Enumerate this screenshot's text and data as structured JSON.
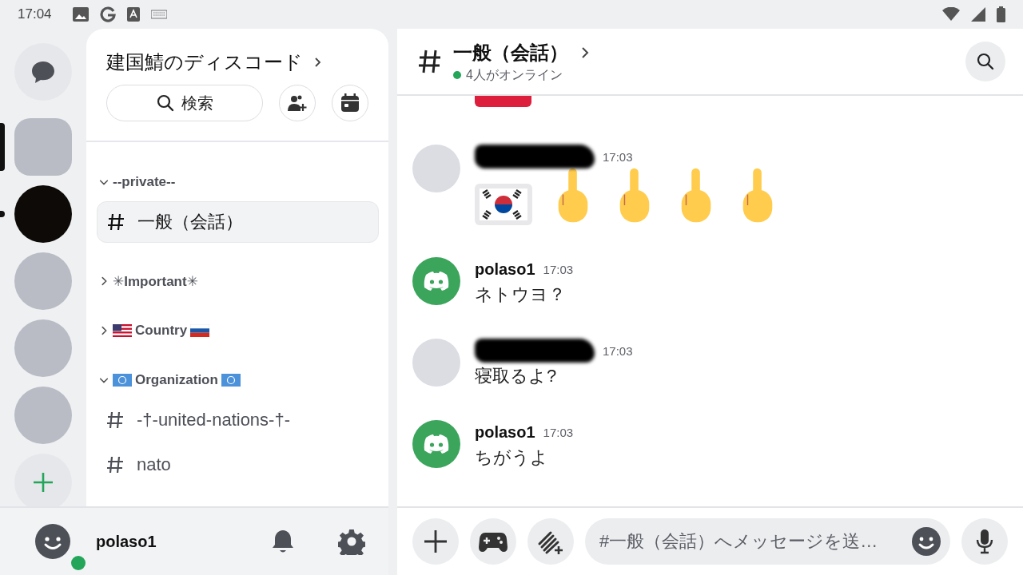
{
  "status_bar": {
    "time": "17:04"
  },
  "servers": [
    {
      "kind": "dm",
      "selected": false,
      "unread": false
    },
    {
      "kind": "photo",
      "selected": true,
      "unread": false
    },
    {
      "kind": "dark",
      "selected": false,
      "unread": true
    },
    {
      "kind": "photo",
      "selected": false,
      "unread": false
    },
    {
      "kind": "photo",
      "selected": false,
      "unread": false
    },
    {
      "kind": "photo",
      "selected": false,
      "unread": false
    },
    {
      "kind": "add",
      "selected": false,
      "unread": false
    }
  ],
  "server": {
    "name": "建国鯖のディスコード",
    "search": "検索"
  },
  "categories": [
    {
      "name": "--private--",
      "expanded": true,
      "channels": [
        {
          "name": "一般（会話）",
          "selected": true
        }
      ]
    },
    {
      "name": "✳Important✳",
      "expanded": false
    },
    {
      "name": "Country",
      "expanded": false,
      "flags": [
        {
          "kind": "us"
        },
        {
          "kind": "ru"
        }
      ]
    },
    {
      "name": "Organization",
      "expanded": true,
      "flags": [
        {
          "kind": "un"
        },
        {
          "kind": "un"
        }
      ],
      "channels": [
        {
          "name": "-†-united-nations-†-",
          "selected": false
        },
        {
          "name": "nato",
          "selected": false
        }
      ]
    }
  ],
  "user": {
    "name": "polaso1",
    "online": true
  },
  "chat": {
    "channel": "一般（会話）",
    "online": "4人がオンライン",
    "messages": [
      {
        "kind": "image"
      },
      {
        "kind": "message",
        "avatar": {
          "kind": "photo"
        },
        "author": {
          "redacted": true
        },
        "time": "17:03",
        "emoji": [
          {
            "kind": "flag"
          },
          {
            "kind": "hand"
          },
          {
            "kind": "hand"
          },
          {
            "kind": "hand"
          },
          {
            "kind": "hand"
          }
        ]
      },
      {
        "kind": "message",
        "avatar": {
          "kind": "default"
        },
        "author": {
          "redacted": false,
          "name": "polaso1"
        },
        "time": "17:03",
        "text": "ネトウヨ？"
      },
      {
        "kind": "message",
        "avatar": {
          "kind": "photo"
        },
        "author": {
          "redacted": true
        },
        "time": "17:03",
        "text": "寝取るよ?"
      },
      {
        "kind": "message",
        "avatar": {
          "kind": "default"
        },
        "author": {
          "redacted": false,
          "name": "polaso1"
        },
        "time": "17:03",
        "text": "ちがうよ"
      }
    ],
    "composer": {
      "placeholder": "#一般（会話）へメッセージを送…"
    }
  }
}
